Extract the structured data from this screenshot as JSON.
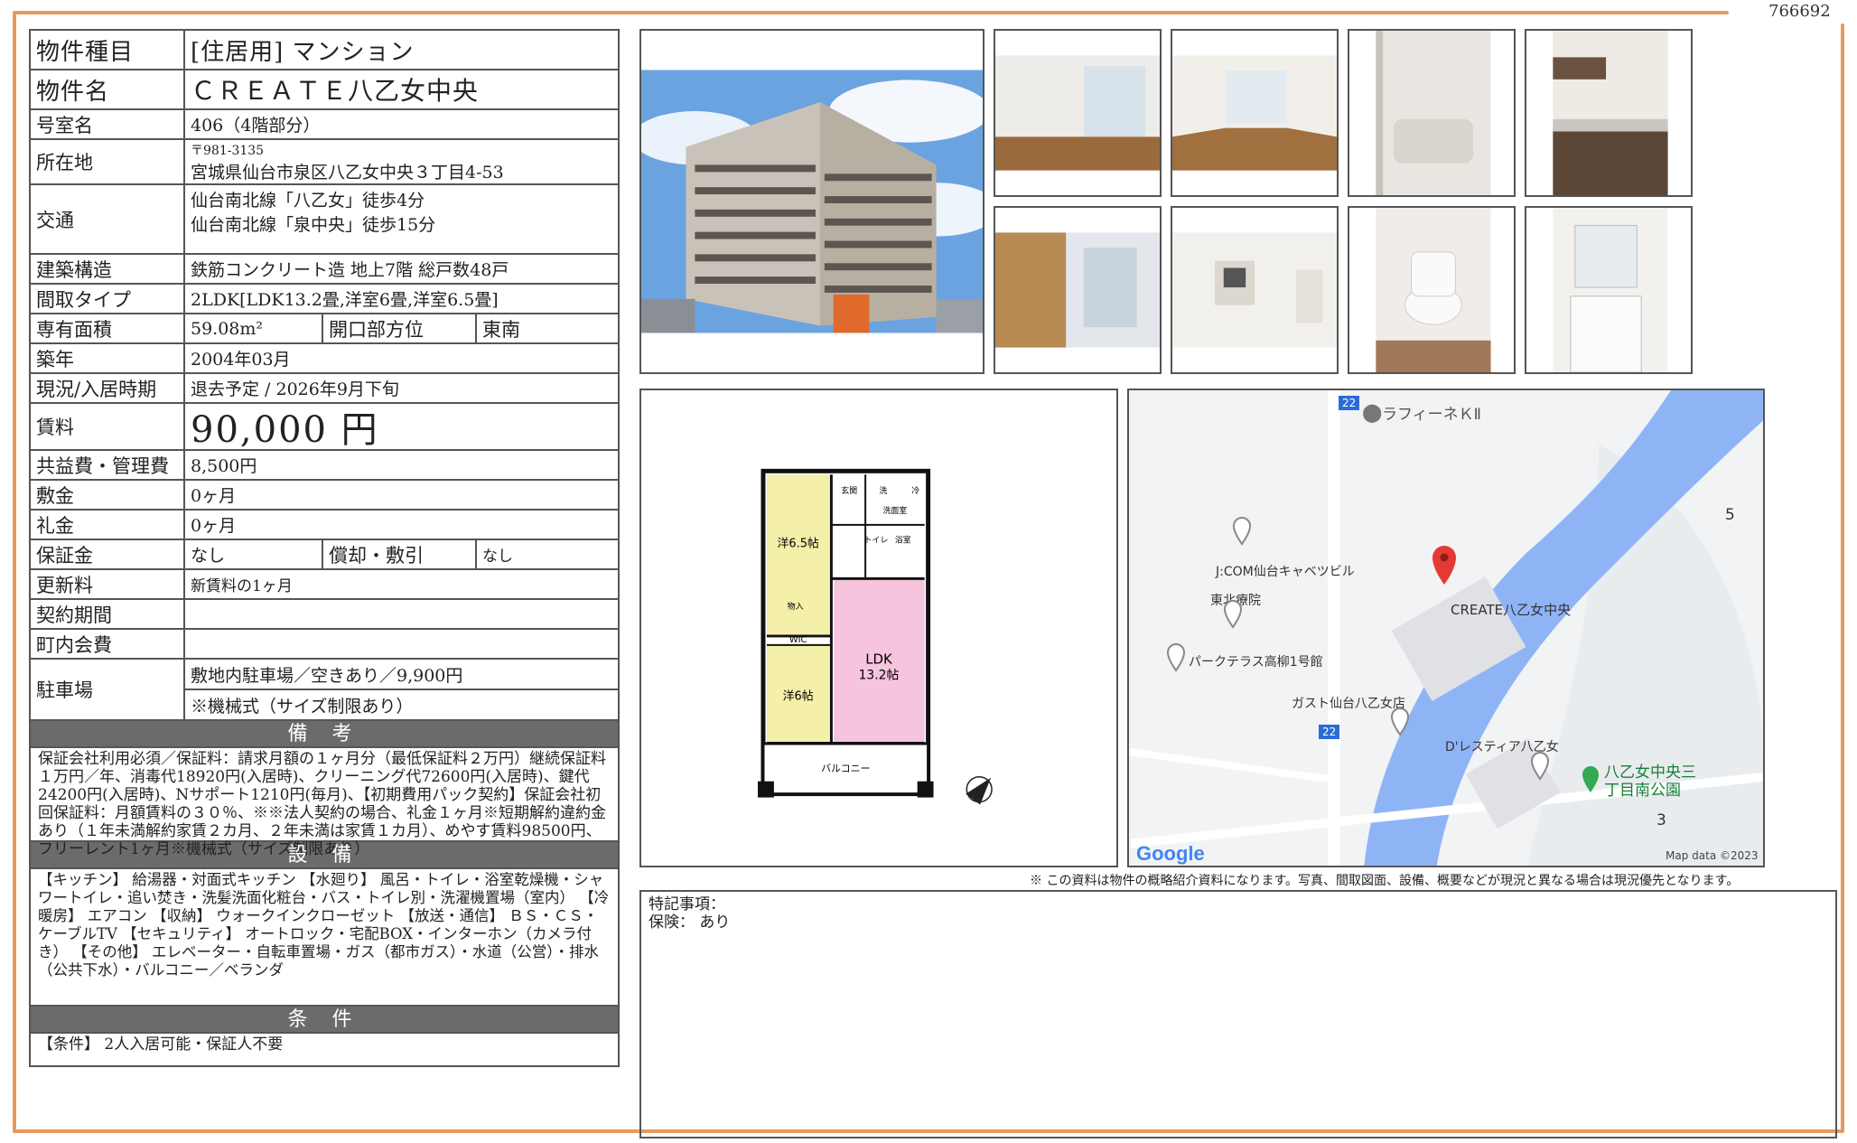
{
  "doc_id": "766692",
  "property": {
    "type_label": "物件種目",
    "type_value": "[住居用] マンション",
    "name_label": "物件名",
    "name_value": "ＣＲＥＡＴＥ八乙女中央",
    "room_label": "号室名",
    "room_value": "406（4階部分）",
    "address_label": "所在地",
    "zip": "〒981-3135",
    "address": "宮城県仙台市泉区八乙女中央３丁目4-53",
    "access_label": "交通",
    "access_1": "仙台南北線「八乙女」徒歩4分",
    "access_2": "仙台南北線「泉中央」徒歩15分",
    "structure_label": "建築構造",
    "structure_value": "鉄筋コンクリート造 地上7階 総戸数48戸",
    "layout_label": "間取タイプ",
    "layout_value": "2LDK[LDK13.2畳,洋室6畳,洋室6.5畳]",
    "area_label": "専有面積",
    "area_value": "59.08m²",
    "direction_label": "開口部方位",
    "direction_value": "東南",
    "built_label": "築年",
    "built_value": "2004年03月",
    "status_label": "現況/入居時期",
    "status_value": "退去予定 / 2026年9月下旬",
    "rent_label": "賃料",
    "rent_value": "90,000 円",
    "fee_label": "共益費・管理費",
    "fee_value": "8,500円",
    "deposit_label": "敷金",
    "deposit_value": "0ヶ月",
    "keymoney_label": "礼金",
    "keymoney_value": "0ヶ月",
    "guarantee_label": "保証金",
    "guarantee_value": "なし",
    "amort_label": "償却・敷引",
    "amort_value": "なし",
    "renewal_label": "更新料",
    "renewal_value": "新賃料の1ヶ月",
    "contract_label": "契約期間",
    "contract_value": "",
    "association_label": "町内会費",
    "association_value": "",
    "parking_label": "駐車場",
    "parking_1": "敷地内駐車場／空きあり／9,900円",
    "parking_2": "※機械式（サイズ制限あり）"
  },
  "notes": {
    "title": "備 考",
    "body": "保証会社利用必須／保証料：請求月額の１ヶ月分（最低保証料２万円）継続保証料１万円／年、消毒代18920円(入居時)、クリーニング代72600円(入居時)、鍵代24200円(入居時)、Nサポート1210円(毎月)、【初期費用パック契約】保証会社初回保証料：月額賃料の３０％、※※法人契約の場合、礼金１ヶ月※短期解約違約金あり（１年未満解約家賃２カ月、２年未満は家賃１カ月）、めやす賃料98500円、フリーレント1ヶ月※機械式（サイズ制限あり）"
  },
  "equipment": {
    "title": "設 備",
    "body": "【キッチン】 給湯器・対面式キッチン 【水廻り】 風呂・トイレ・浴室乾燥機・シャワートイレ・追い焚き・洗髪洗面化粧台・バス・トイレ別・洗濯機置場（室内） 【冷暖房】 エアコン 【収納】 ウォークインクローゼット 【放送・通信】 ＢＳ・ＣＳ・ケーブルTV 【セキュリティ】 オートロック・宅配BOX・インターホン（カメラ付き） 【その他】 エレベーター・自転車置場・ガス（都市ガス）・水道（公営）・排水（公共下水）・バルコニー／ベランダ"
  },
  "conditions": {
    "title": "条 件",
    "body": "【条件】 2人入居可能・保証人不要"
  },
  "floorplan": {
    "room_a": "洋6.5帖",
    "room_b": "洋6帖",
    "ldk": "LDK",
    "ldk_size": "13.2帖",
    "wic": "WIC",
    "balcony": "バルコニー",
    "entrance": "玄関",
    "washroom": "洗面室",
    "toilet": "トイレ",
    "bath": "浴室",
    "storage": "物入",
    "wash": "洗",
    "fridge": "冷"
  },
  "map": {
    "road_no": "22",
    "poi_1": "ラフィーネＫⅡ",
    "poi_2": "J:COM仙台キャベツビル",
    "poi_3": "東北療院",
    "poi_4": "パークテラス高柳1号館",
    "poi_5": "CREATE八乙女中央",
    "poi_6": "ガスト仙台八乙女店",
    "poi_7": "D'レスティア八乙女",
    "poi_8a": "八乙女中央三",
    "poi_8b": "丁目南公園",
    "num_5": "5",
    "num_3": "3",
    "google": "Google",
    "credit": "Map data ©2023"
  },
  "notice": "※ この資料は物件の概略紹介資料になります。写真、間取図面、設備、概要などが現況と異なる場合は現況優先となります。",
  "remarks": {
    "line1": "特記事項：",
    "line2": "保険： あり"
  },
  "colors": {
    "accent": "#e89a5c",
    "header_bg": "#6b6b6b",
    "map_pin": "#e53935",
    "river": "#7aa7f5",
    "park": "#34a853"
  }
}
